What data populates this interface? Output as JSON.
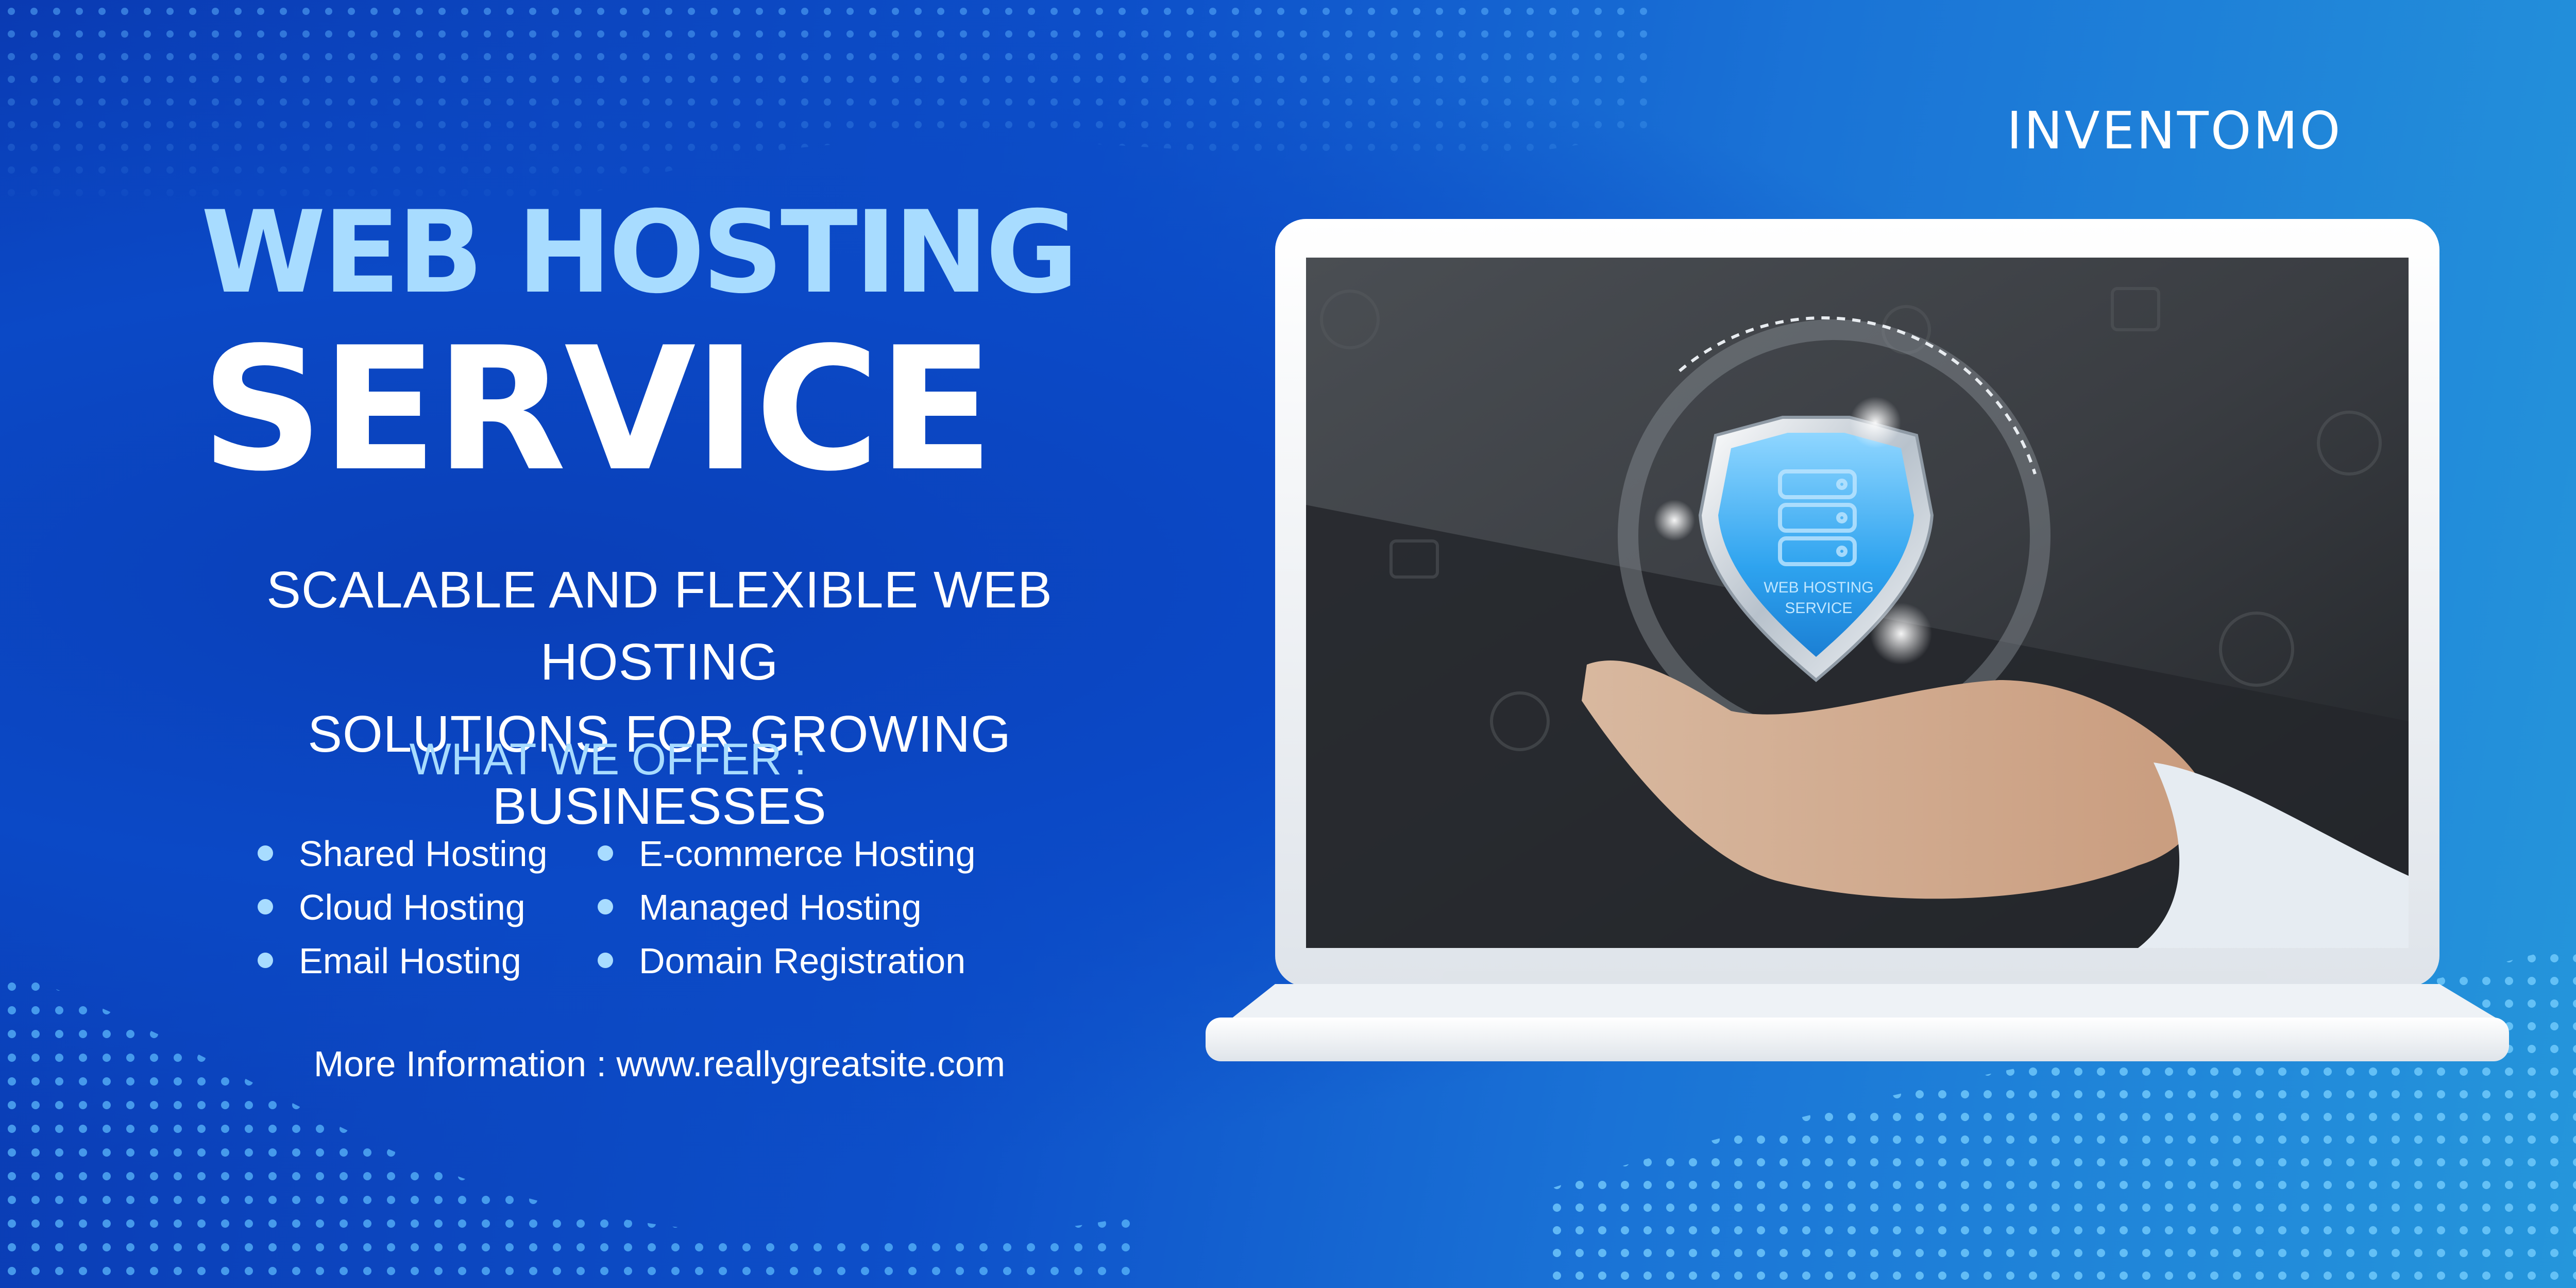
{
  "brand": "INVENTOMO",
  "headline": {
    "line1": "WEB HOSTING",
    "line2": "SERVICE"
  },
  "subtitle": {
    "line1": "SCALABLE AND FLEXIBLE WEB HOSTING",
    "line2": "SOLUTIONS FOR GROWING BUSINESSES"
  },
  "offer_heading": "WHAT WE OFFER :",
  "services": {
    "left": [
      "Shared Hosting",
      "Cloud Hosting",
      "Email Hosting"
    ],
    "right": [
      "E-commerce Hosting",
      "Managed Hosting",
      "Domain Registration"
    ]
  },
  "more_info": "More Information : www.reallygreatsite.com",
  "shield_text": {
    "line1": "WEB HOSTING",
    "line2": "SERVICE"
  },
  "colors": {
    "accent": "#a8dcff",
    "bg_dark": "#0a3ab2",
    "bg_light": "#2596db",
    "text": "#ffffff"
  },
  "icons": [
    "server-icon",
    "shield-icon",
    "hand-image",
    "laptop-image"
  ]
}
